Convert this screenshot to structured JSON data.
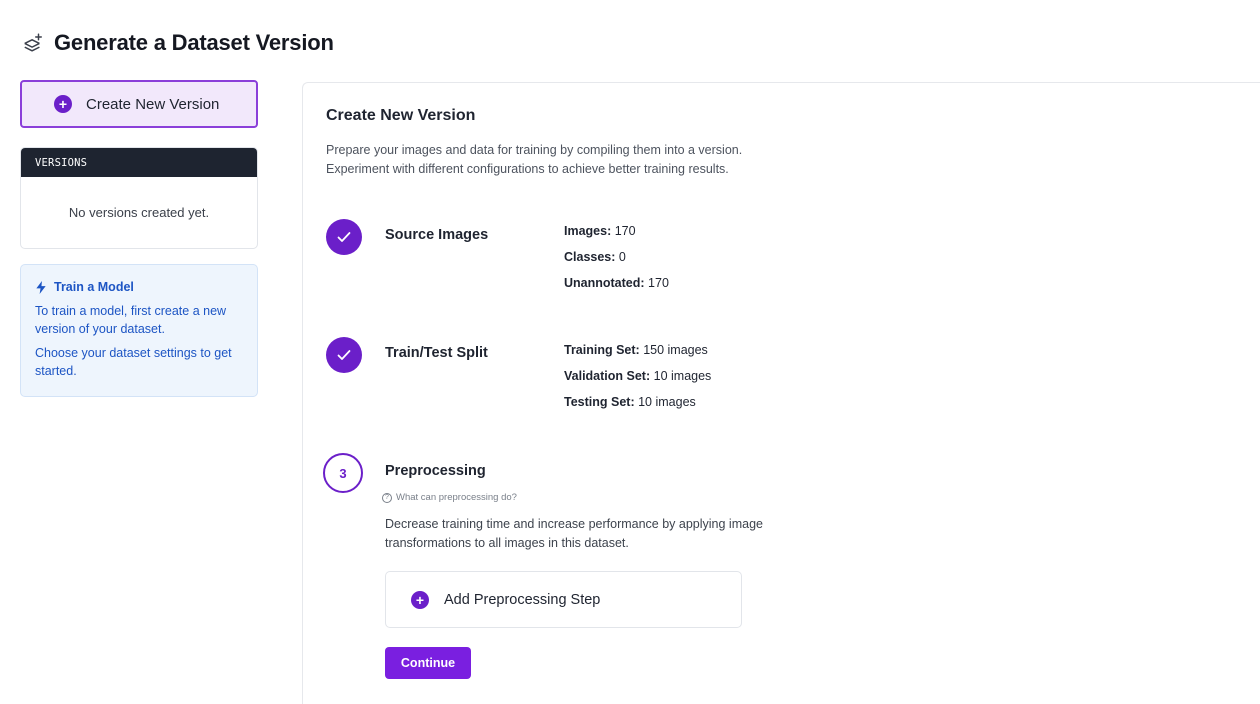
{
  "header": {
    "title": "Generate a Dataset Version",
    "icon": "layers-icon"
  },
  "sidebar": {
    "create_button": "Create New Version",
    "versions_heading": "VERSIONS",
    "versions_empty": "No versions created yet.",
    "train_card": {
      "title": "Train a Model",
      "line1": "To train a model, first create a new version of your dataset.",
      "line2": "Choose your dataset settings to get started."
    }
  },
  "main": {
    "title": "Create New Version",
    "description_line1": "Prepare your images and data for training by compiling them into a version.",
    "description_line2": "Experiment with different configurations to achieve better training results.",
    "steps": [
      {
        "name": "Source Images",
        "status": "complete",
        "stats": [
          {
            "key": "Images:",
            "value": "170"
          },
          {
            "key": "Classes:",
            "value": "0"
          },
          {
            "key": "Unannotated:",
            "value": "170"
          }
        ]
      },
      {
        "name": "Train/Test Split",
        "status": "complete",
        "stats": [
          {
            "key": "Training Set:",
            "value": "150 images"
          },
          {
            "key": "Validation Set:",
            "value": "10 images"
          },
          {
            "key": "Testing Set:",
            "value": "10 images"
          }
        ]
      },
      {
        "number": "3",
        "name": "Preprocessing",
        "status": "active",
        "help_link": "What can preprocessing do?",
        "description_line1": "Decrease training time and increase performance by applying image",
        "description_line2": "transformations to all images in this dataset.",
        "add_button": "Add Preprocessing Step",
        "continue_button": "Continue"
      }
    ]
  },
  "colors": {
    "accent": "#6b1fc9",
    "button": "#7a1fe0",
    "info": "#1d55c4"
  }
}
